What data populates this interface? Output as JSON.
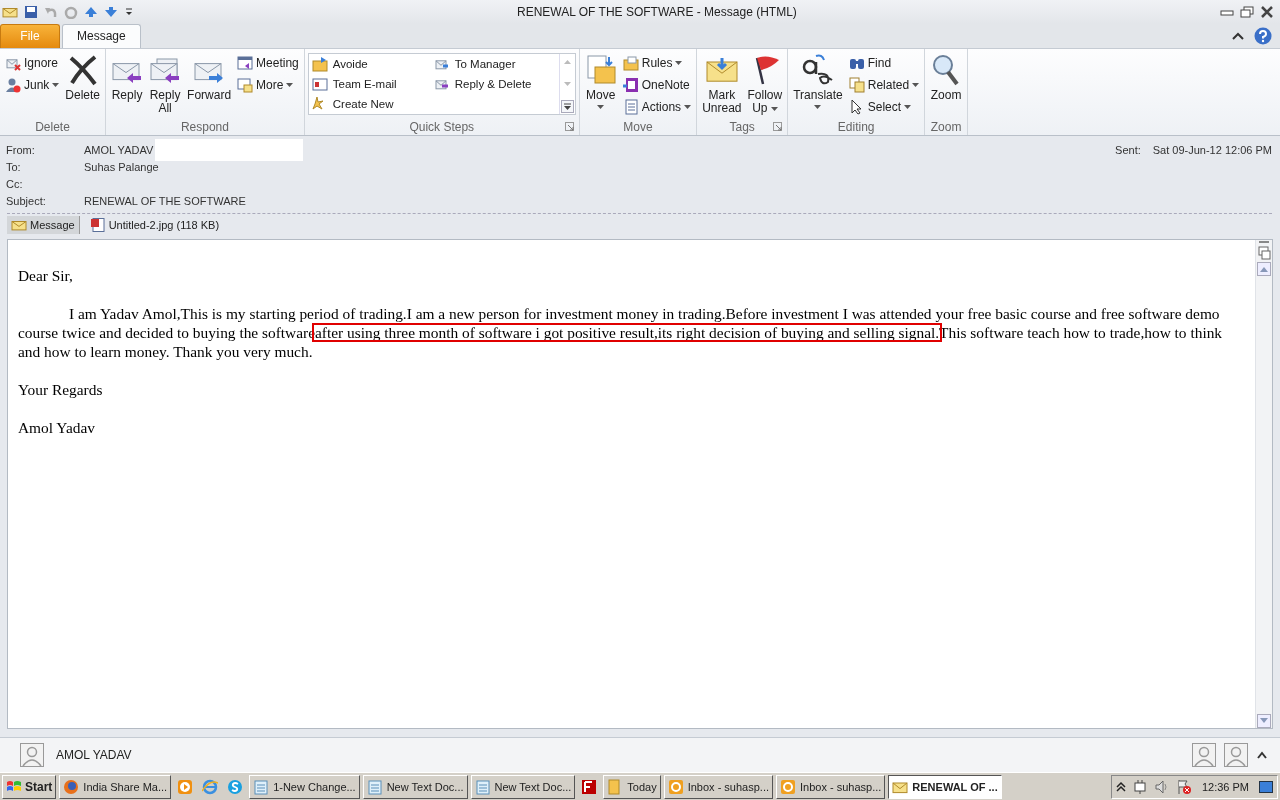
{
  "window": {
    "title": "RENEWAL OF THE SOFTWARE  -  Message (HTML)"
  },
  "ribbon_tabs": [
    {
      "label": "File",
      "kind": "file",
      "selected": false
    },
    {
      "label": "Message",
      "kind": "tab",
      "selected": true
    }
  ],
  "ribbon_groups": [
    {
      "label": "Delete",
      "items": [
        {
          "label": "Ignore",
          "kind": "small"
        },
        {
          "label": "Junk",
          "kind": "small",
          "dropdown": true
        },
        {
          "label": "Delete",
          "kind": "large"
        }
      ]
    },
    {
      "label": "Respond",
      "items": [
        {
          "label": "Reply",
          "kind": "large"
        },
        {
          "label": "Reply All",
          "kind": "large"
        },
        {
          "label": "Forward",
          "kind": "large"
        },
        {
          "label": "Meeting",
          "kind": "small"
        },
        {
          "label": "More",
          "kind": "small",
          "dropdown": true
        }
      ]
    },
    {
      "label": "Quick Steps",
      "launcher": true,
      "items": [
        {
          "label": "Avoide",
          "kind": "gallery"
        },
        {
          "label": "To Manager",
          "kind": "gallery"
        },
        {
          "label": "Team E-mail",
          "kind": "gallery"
        },
        {
          "label": "Reply & Delete",
          "kind": "gallery"
        },
        {
          "label": "Create New",
          "kind": "gallery"
        }
      ]
    },
    {
      "label": "Move",
      "items": [
        {
          "label": "Move",
          "kind": "large",
          "dropdown": true
        },
        {
          "label": "Rules",
          "kind": "small",
          "dropdown": true
        },
        {
          "label": "OneNote",
          "kind": "small"
        },
        {
          "label": "Actions",
          "kind": "small",
          "dropdown": true
        }
      ]
    },
    {
      "label": "Tags",
      "launcher": true,
      "items": [
        {
          "label": "Mark Unread",
          "kind": "large"
        },
        {
          "label": "Follow Up",
          "kind": "large",
          "dropdown": true
        }
      ]
    },
    {
      "label": "Editing",
      "items": [
        {
          "label": "Translate",
          "kind": "large",
          "dropdown": true
        },
        {
          "label": "Find",
          "kind": "small"
        },
        {
          "label": "Related",
          "kind": "small",
          "dropdown": true
        },
        {
          "label": "Select",
          "kind": "small",
          "dropdown": true
        }
      ]
    },
    {
      "label": "Zoom",
      "items": [
        {
          "label": "Zoom",
          "kind": "large"
        }
      ]
    }
  ],
  "header": {
    "fields": [
      {
        "label": "From:",
        "value": "AMOL YADAV"
      },
      {
        "label": "To:",
        "value": "Suhas Palange"
      },
      {
        "label": "Cc:"
      },
      {
        "label": "Subject:",
        "value": "RENEWAL OF THE SOFTWARE"
      }
    ],
    "sent_label": "Sent:",
    "sent_value": "Sat 09-Jun-12 12:06 PM"
  },
  "attachments": [
    {
      "label": "Message",
      "kind": "message",
      "selected": true
    },
    {
      "label": "Untitled-2.jpg (118 KB)",
      "kind": "file",
      "selected": false
    }
  ],
  "body": {
    "paragraphs": [
      {
        "indent": false,
        "segments": [
          {
            "text": "Dear Sir,",
            "highlighted": false
          }
        ]
      },
      {
        "indent": true,
        "segments": [
          {
            "text": "I am Yadav Amol,This is my starting period of trading.I am a new person for investment money in trading.Before investment I was attended your free basic course and free software demo course twice and decided to buying the software",
            "highlighted": false
          },
          {
            "text": "after using three month of software i got positive result,its right decision of buying and selling signal.",
            "highlighted": true
          },
          {
            "text": "This software teach how to trade,how to think and how to learn money. Thank you very much.",
            "highlighted": false
          }
        ]
      },
      {
        "indent": false,
        "segments": [
          {
            "text": "Your Regards",
            "highlighted": false
          }
        ]
      },
      {
        "indent": false,
        "segments": [
          {
            "text": "Amol Yadav",
            "highlighted": false
          }
        ]
      }
    ]
  },
  "people_pane": {
    "name": "AMOL YADAV"
  },
  "taskbar": {
    "start": "Start",
    "items": [
      {
        "kind": "window",
        "label": "India Share Ma...",
        "selected": false
      },
      {
        "kind": "icon",
        "selected": false
      },
      {
        "kind": "icon",
        "selected": false
      },
      {
        "kind": "icon",
        "selected": false
      },
      {
        "kind": "window",
        "label": "1-New Change...",
        "selected": false
      },
      {
        "kind": "window",
        "label": "New Text Doc...",
        "selected": false
      },
      {
        "kind": "window",
        "label": "New Text Doc...",
        "selected": false
      },
      {
        "kind": "icon",
        "selected": false
      },
      {
        "kind": "window",
        "label": "Today",
        "selected": false
      },
      {
        "kind": "window",
        "label": "Inbox - suhasp...",
        "selected": false
      },
      {
        "kind": "window",
        "label": "Inbox - suhasp...",
        "selected": false
      },
      {
        "kind": "window",
        "label": "RENEWAL OF ...",
        "selected": true
      }
    ],
    "clock": "12:36 PM"
  }
}
